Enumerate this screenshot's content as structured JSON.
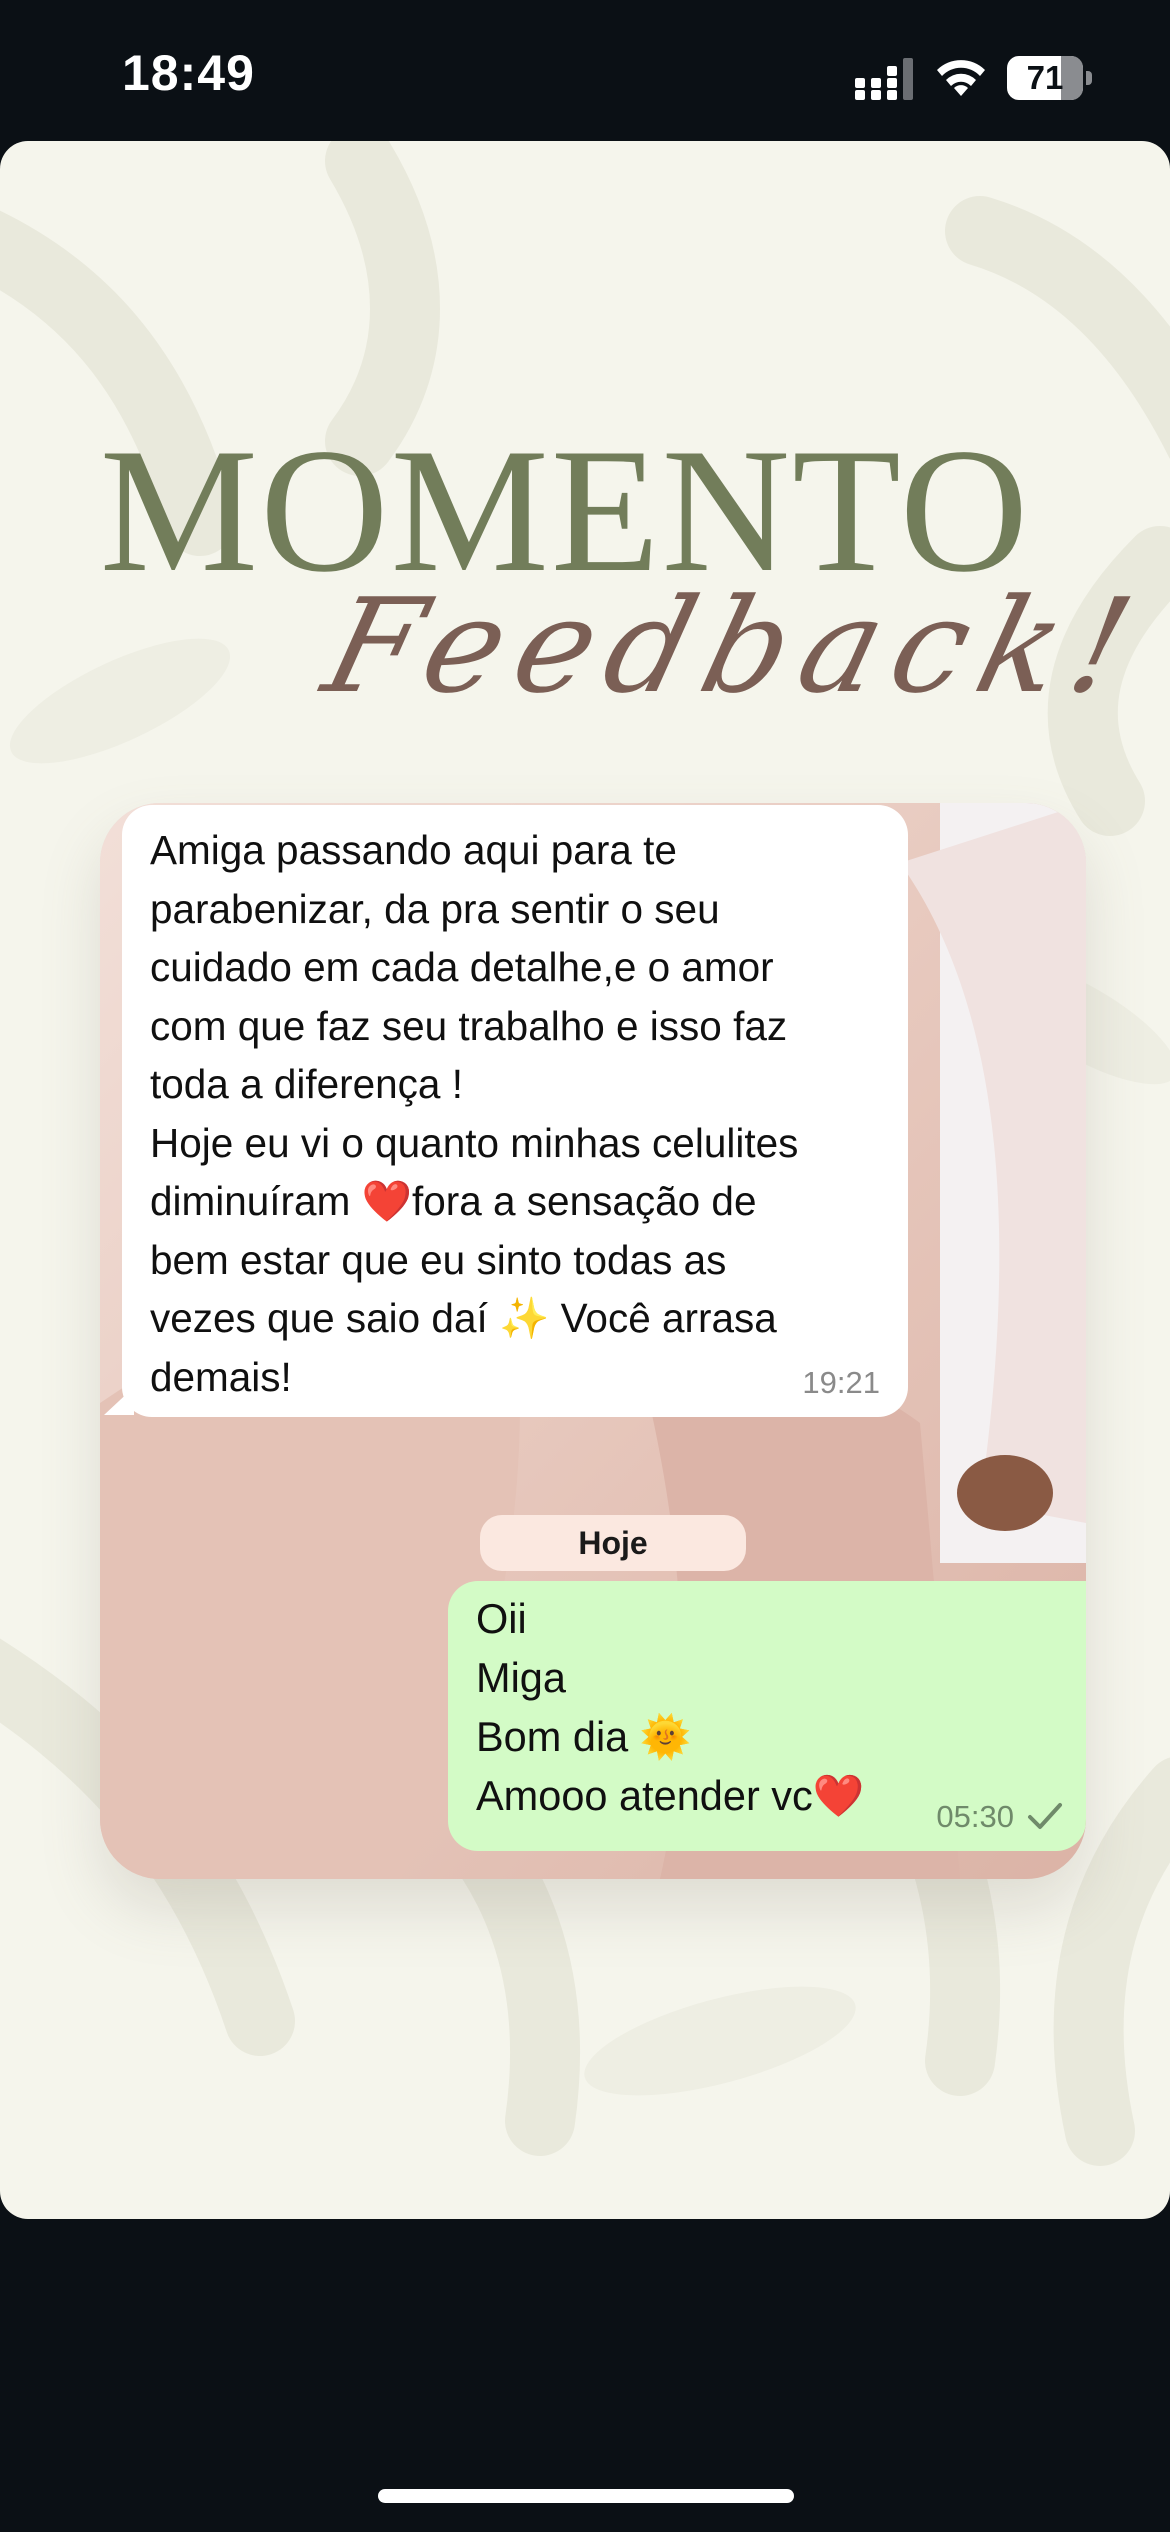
{
  "status_bar": {
    "time": "18:49",
    "battery_percent": "71",
    "battery_level": 0.71
  },
  "story": {
    "title": "MOMENTO",
    "subtitle": "Feedback!"
  },
  "chat": {
    "received": {
      "text": "Amiga passando aqui para te\nparabenizar, da  pra sentir o seu\ncuidado em cada detalhe,e o amor\ncom que faz seu trabalho e isso faz\ntoda a diferença !\nHoje eu vi o quanto minhas celulites\ndiminuíram ❤️fora a sensação de\nbem estar que eu sinto todas as\nvezes que saio daí ✨ Você arrasa\ndemais!",
      "time": "19:21"
    },
    "date_separator": "Hoje",
    "sent": {
      "text": "Oii\nMiga\nBom dia 🌞\nAmooo atender vc❤️",
      "time": "05:30"
    }
  },
  "icons": {
    "signal": "cellular-signal-icon",
    "wifi": "wifi-icon",
    "battery": "battery-icon",
    "check": "single-check-icon"
  },
  "colors": {
    "background": "#0b1015",
    "card": "#f5f5ec",
    "title_green": "#727d5a",
    "script_brown": "#7b5f55",
    "sent_bubble": "#d3fbc6",
    "received_bubble": "#ffffff"
  }
}
